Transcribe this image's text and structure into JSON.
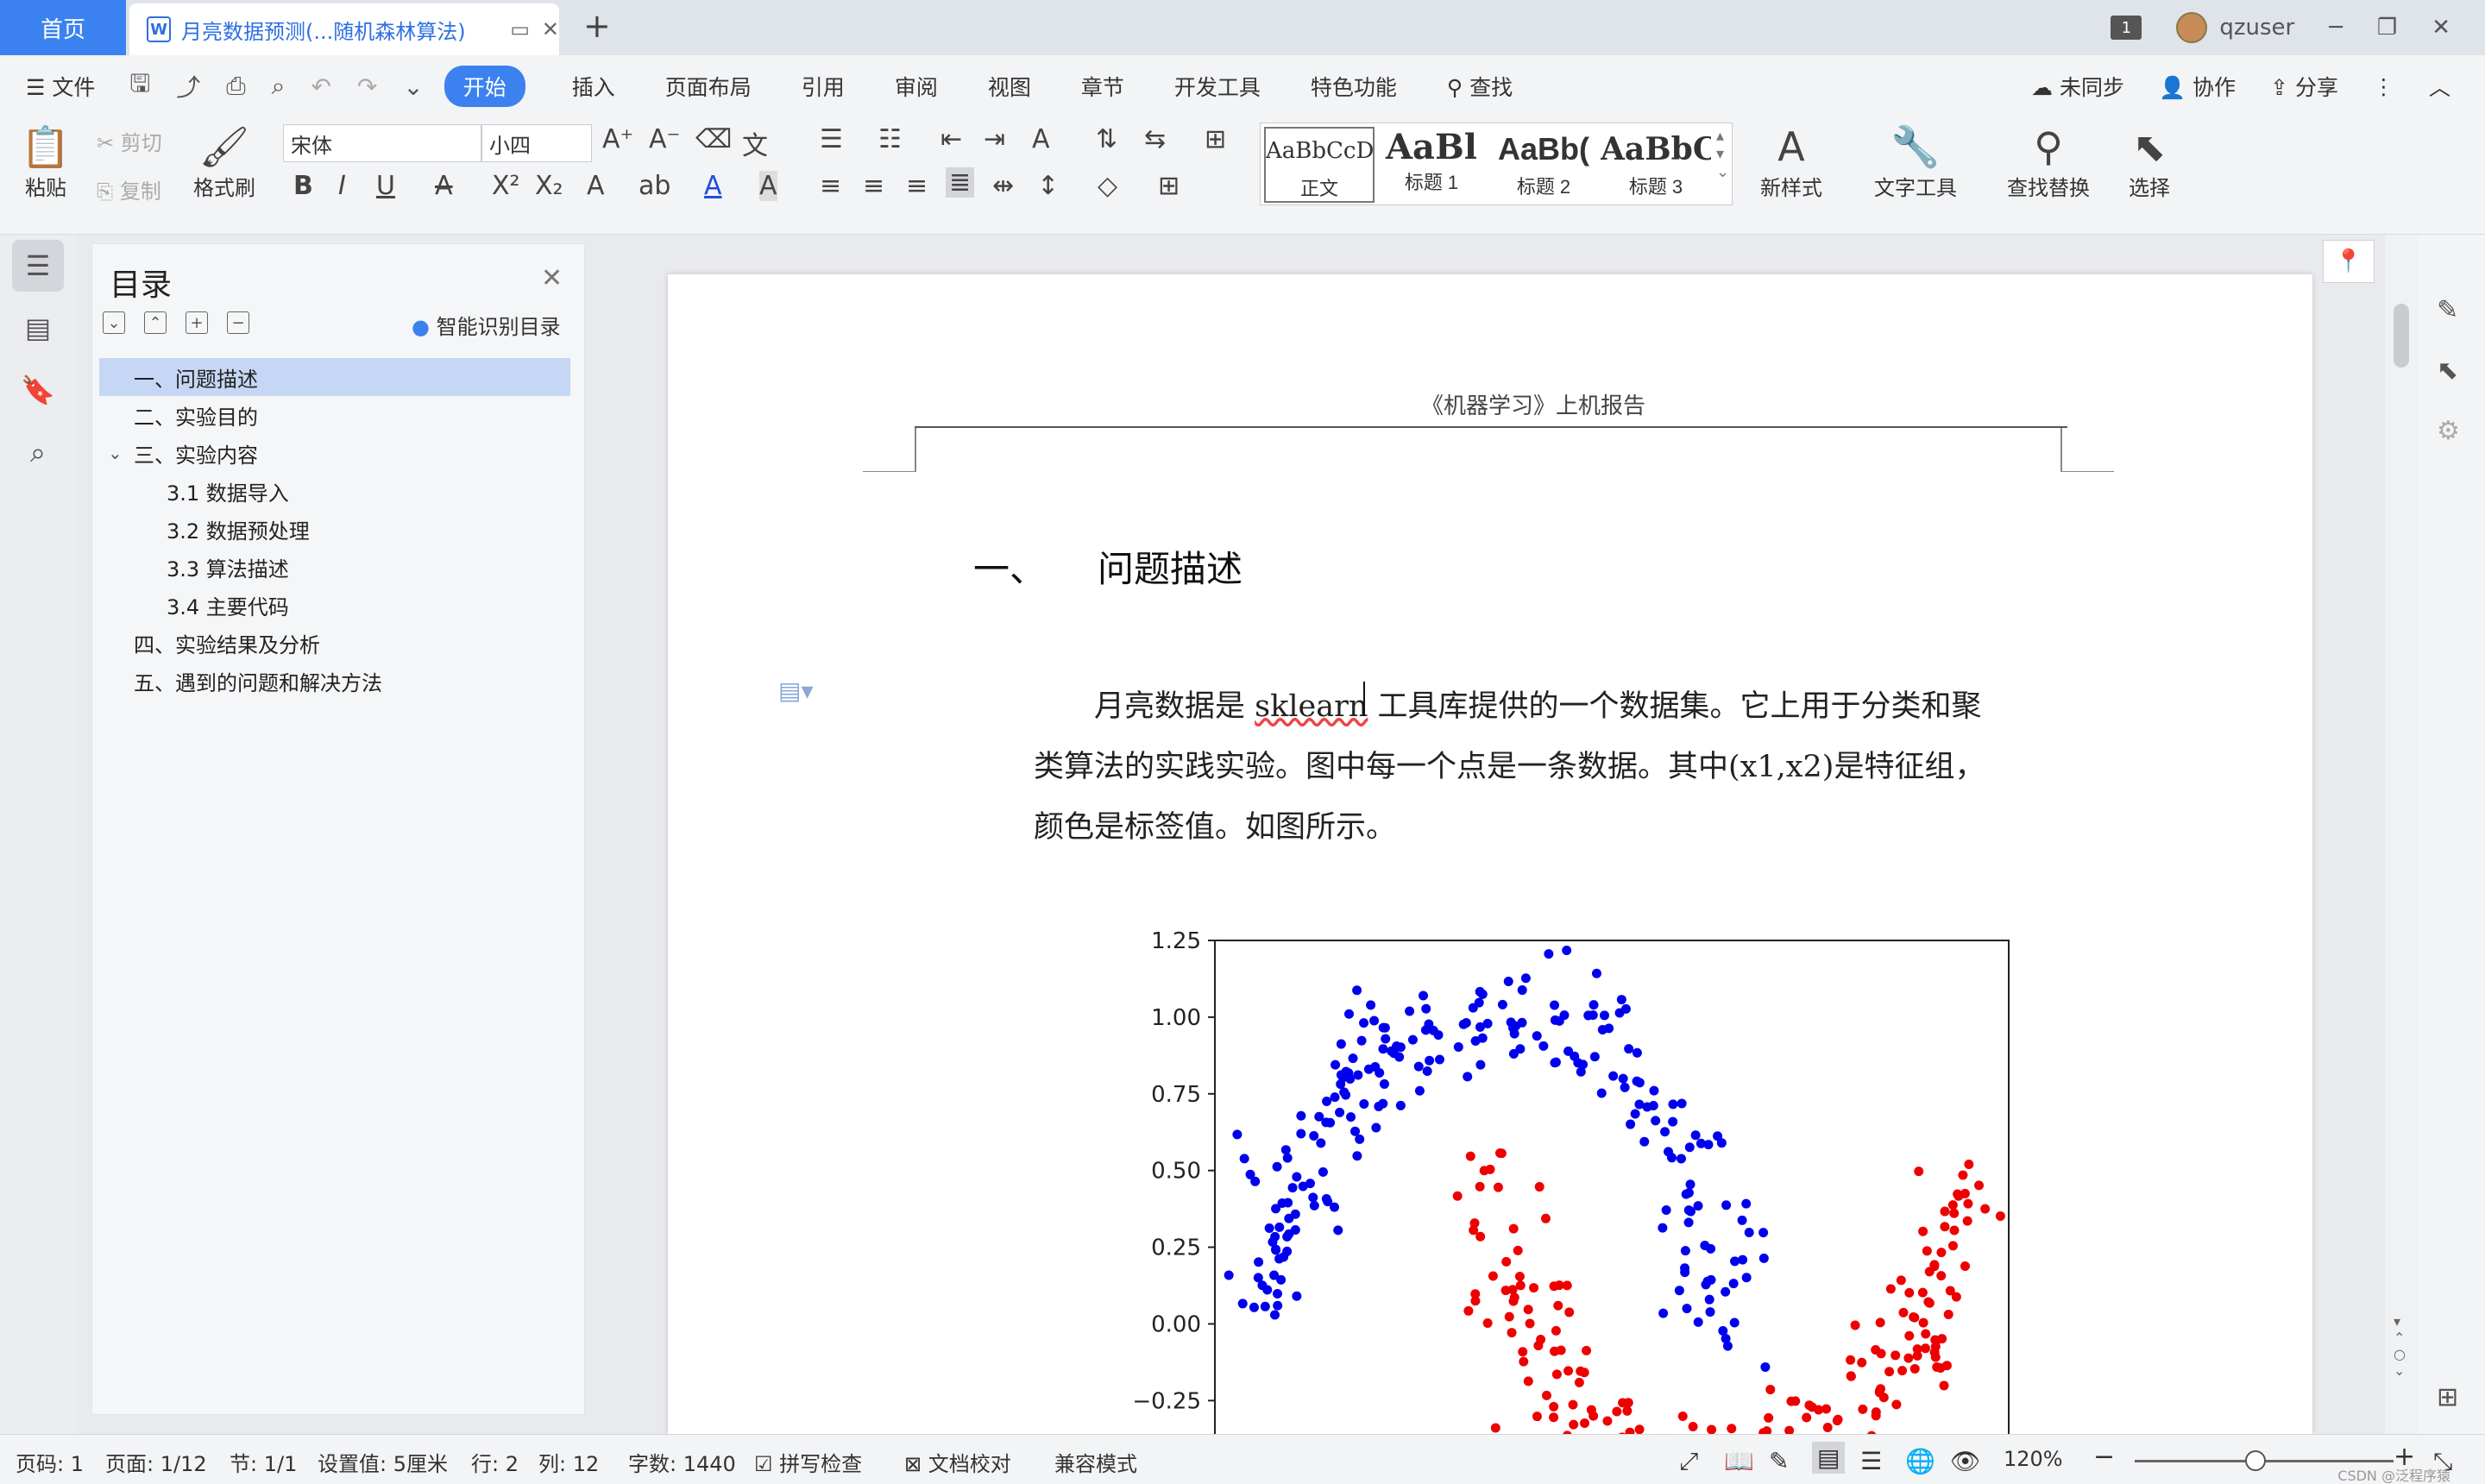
{
  "tabs": {
    "home": "首页",
    "doc_title": "月亮数据预测(...随机森林算法)",
    "add": "+",
    "badge": "1",
    "user": "qzuser"
  },
  "menu": {
    "file": "文件",
    "items": [
      "开始",
      "插入",
      "页面布局",
      "引用",
      "审阅",
      "视图",
      "章节",
      "开发工具",
      "特色功能"
    ],
    "search": "查找",
    "sync": "未同步",
    "collab": "协作",
    "share": "分享"
  },
  "ribbon": {
    "paste": "粘贴",
    "cut": "剪切",
    "copy": "复制",
    "format_painter": "格式刷",
    "font_name": "宋体",
    "font_size": "小四",
    "styles": [
      {
        "preview": "AaBbCcDd",
        "name": "正文"
      },
      {
        "preview": "AaBl",
        "name": "标题 1"
      },
      {
        "preview": "AaBb(",
        "name": "标题 2"
      },
      {
        "preview": "AaBbC",
        "name": "标题 3"
      }
    ],
    "new_style": "新样式",
    "text_tools": "文字工具",
    "find_replace": "查找替换",
    "select": "选择"
  },
  "nav": {
    "title": "目录",
    "smart": "智能识别目录",
    "items": [
      {
        "label": "一、问题描述",
        "level": 1,
        "active": true
      },
      {
        "label": "二、实验目的",
        "level": 1,
        "active": false
      },
      {
        "label": "三、实验内容",
        "level": 1,
        "active": false,
        "expanded": true
      },
      {
        "label": "3.1 数据导入",
        "level": 2,
        "active": false
      },
      {
        "label": "3.2 数据预处理",
        "level": 2,
        "active": false
      },
      {
        "label": "3.3 算法描述",
        "level": 2,
        "active": false
      },
      {
        "label": "3.4 主要代码",
        "level": 2,
        "active": false
      },
      {
        "label": "四、实验结果及分析",
        "level": 1,
        "active": false
      },
      {
        "label": "五、遇到的问题和解决方法",
        "level": 1,
        "active": false
      }
    ]
  },
  "doc": {
    "header": "《机器学习》上机报告",
    "heading_num": "一、",
    "heading": "问题描述",
    "para_line1_a": "月亮数据是",
    "para_line1_b": "sklearn",
    "para_line1_c": "工具库提供的一个数据集。它上用于分类和聚",
    "para_line2": "类算法的实践实验。图中每一个点是一条数据。其中(x1,x2)是特征组，",
    "para_line3": "颜色是标签值。如图所示。"
  },
  "status": {
    "page_code": "页码: 1",
    "page": "页面: 1/12",
    "section": "节: 1/1",
    "setting": "设置值: 5厘米",
    "row": "行: 2",
    "col": "列: 12",
    "words": "字数: 1440",
    "spell": "拼写检查",
    "proof": "文档校对",
    "compat": "兼容模式",
    "zoom": "120%",
    "watermark": "CSDN @泛程序猿"
  },
  "chart_data": {
    "type": "scatter",
    "title": "",
    "xlabel": "",
    "ylabel": "",
    "ylim": [
      -0.37,
      1.25
    ],
    "yticks": [
      "1.25",
      "1.00",
      "0.75",
      "0.50",
      "0.25",
      "0.00",
      "−0.25"
    ],
    "yticks_values": [
      1.25,
      1.0,
      0.75,
      0.5,
      0.25,
      0.0,
      -0.25
    ],
    "xlim": [
      -1.25,
      2.25
    ],
    "series": [
      {
        "color": "#0000ee",
        "shape": "upper-moon",
        "center": [
          0.0,
          0.0
        ],
        "radius": 1.0,
        "count": 230
      },
      {
        "color": "#ee0000",
        "shape": "lower-moon",
        "center": [
          1.0,
          0.5
        ],
        "radius": 1.0,
        "count": 230
      }
    ],
    "noise": 0.1
  }
}
